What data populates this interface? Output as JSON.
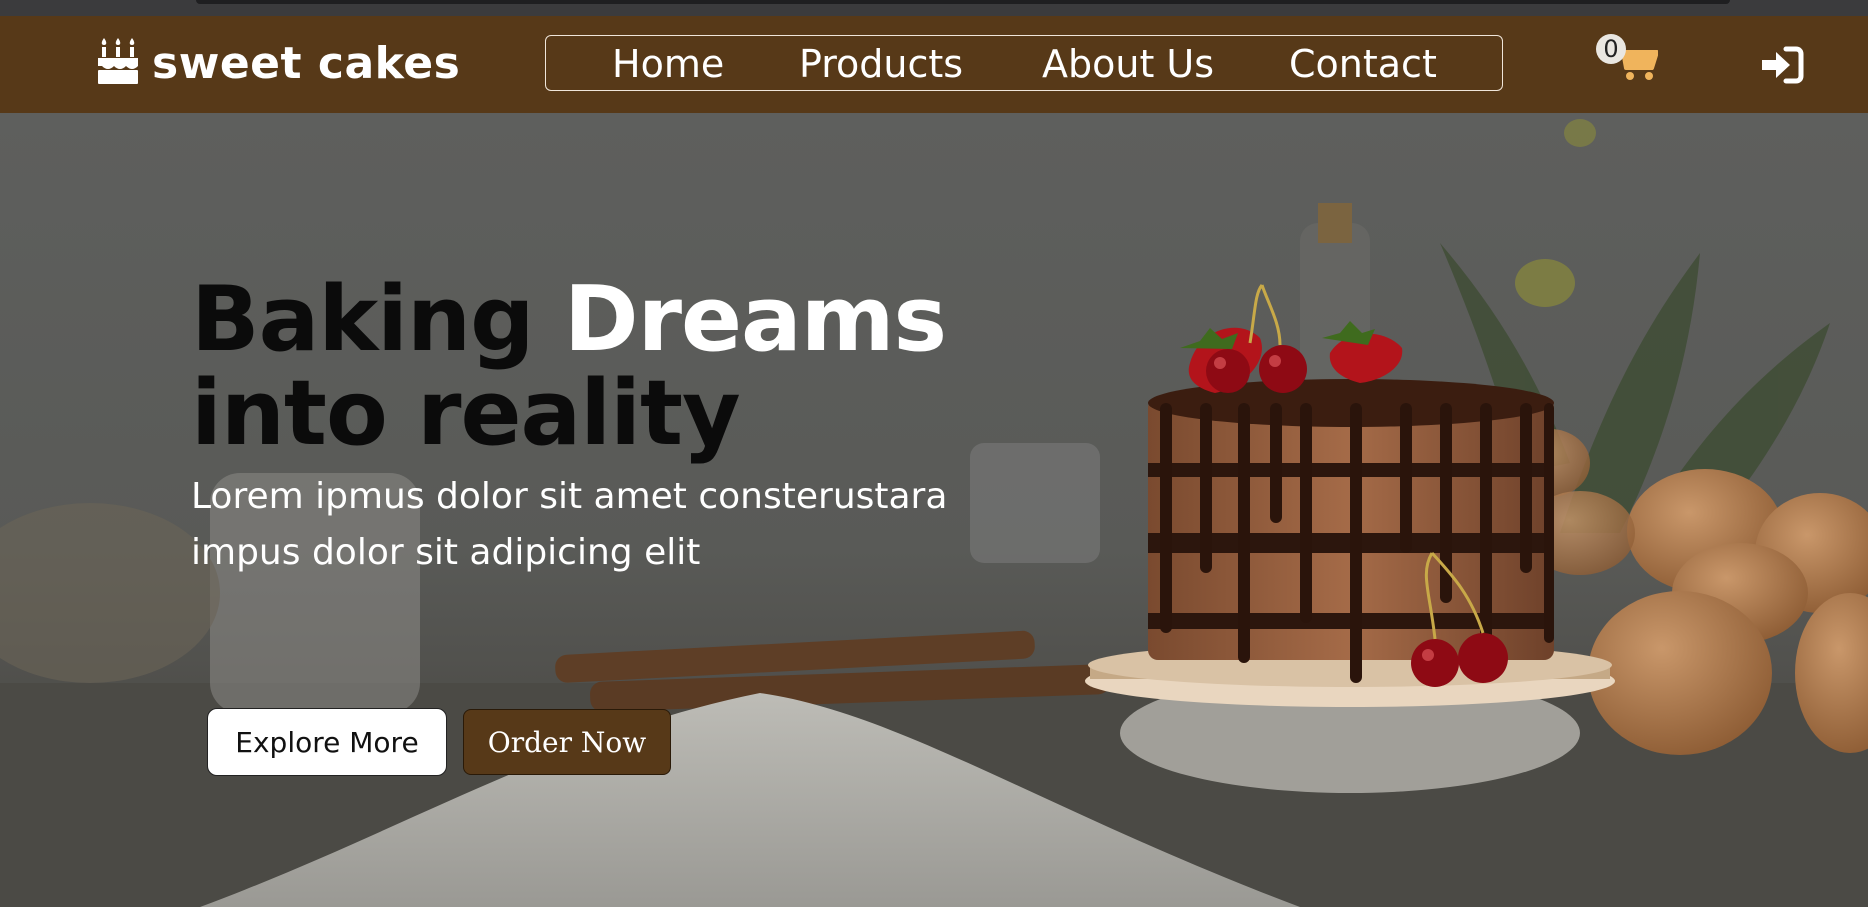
{
  "brand": {
    "name": "sweet cakes",
    "icon": "birthday-cake-icon"
  },
  "nav": {
    "links": [
      {
        "label": "Home"
      },
      {
        "label": "Products"
      },
      {
        "label": "About Us"
      },
      {
        "label": "Contact"
      }
    ]
  },
  "cart": {
    "count": "0",
    "icon": "shopping-cart-icon"
  },
  "login": {
    "icon": "sign-in-icon"
  },
  "hero": {
    "title_dark_1": "Baking",
    "title_light": "Dreams",
    "title_dark_2": "into reality",
    "subtitle": "Lorem ipmus dolor sit amet consterustara impus dolor sit adipicing elit",
    "explore_label": "Explore More",
    "order_label": "Order Now",
    "image": "chocolate-drip-cake-with-strawberries-and-cherries"
  },
  "colors": {
    "brand_brown": "#573918",
    "cart_accent": "#f0b45c",
    "white": "#ffffff",
    "title_dark": "#0b0b0b"
  }
}
